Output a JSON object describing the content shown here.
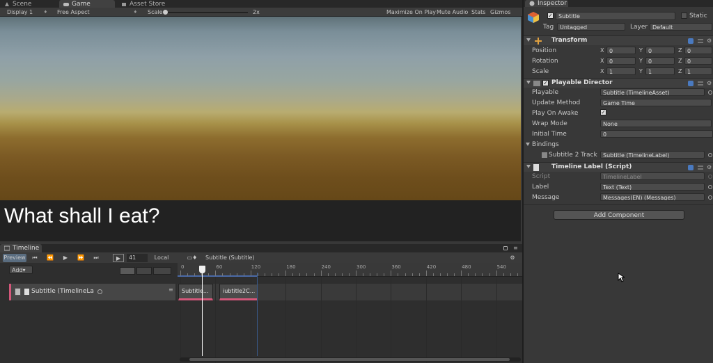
{
  "tabs": {
    "scene": "Scene",
    "game": "Game",
    "asset_store": "Asset Store",
    "inspector": "Inspector",
    "timeline": "Timeline"
  },
  "game_toolbar": {
    "display": "Display 1",
    "aspect": "Free Aspect",
    "scale_label": "Scale",
    "scale_value": "2x",
    "maximize": "Maximize On Play",
    "mute": "Mute Audio",
    "stats": "Stats",
    "gizmos": "Gizmos"
  },
  "game_view": {
    "subtitle": "What shall I eat?"
  },
  "timeline": {
    "preview": "Preview",
    "frame": "41",
    "space": "Local",
    "asset": "Subtitle (Subtitle)",
    "add": "Add",
    "track_name": "Subtitle (TimelineLa",
    "ruler_ticks": [
      "0",
      "60",
      "120",
      "180",
      "240",
      "300",
      "360",
      "420",
      "480",
      "540"
    ],
    "clips": [
      "Subtitle...",
      "iubtitle2C..."
    ]
  },
  "inspector": {
    "object_name": "Subtitle",
    "static_label": "Static",
    "tag_label": "Tag",
    "tag_value": "Untagged",
    "layer_label": "Layer",
    "layer_value": "Default",
    "transform": {
      "title": "Transform",
      "rows": [
        {
          "label": "Position",
          "x": "0",
          "y": "0",
          "z": "0"
        },
        {
          "label": "Rotation",
          "x": "0",
          "y": "0",
          "z": "0"
        },
        {
          "label": "Scale",
          "x": "1",
          "y": "1",
          "z": "1"
        }
      ],
      "axis_x": "X",
      "axis_y": "Y",
      "axis_z": "Z"
    },
    "director": {
      "title": "Playable Director",
      "playable_label": "Playable",
      "playable_value": "Subtitle (TimelineAsset)",
      "update_label": "Update Method",
      "update_value": "Game Time",
      "awake_label": "Play On Awake",
      "wrap_label": "Wrap Mode",
      "wrap_value": "None",
      "initial_label": "Initial Time",
      "initial_value": "0",
      "bindings_label": "Bindings",
      "binding_track": "Subtitle 2 Track",
      "binding_value": "Subtitle (TimelineLabel)"
    },
    "label_script": {
      "title": "Timeline Label (Script)",
      "script_label": "Script",
      "script_value": "TimelineLabel",
      "label_label": "Label",
      "label_value": "Text (Text)",
      "message_label": "Message",
      "message_value": "Messages(EN) (Messages)"
    },
    "add_component": "Add Component"
  },
  "colors": {
    "accent_clip": "#d4577a",
    "playhead": "#ffffff",
    "panel_bg": "#383838"
  }
}
